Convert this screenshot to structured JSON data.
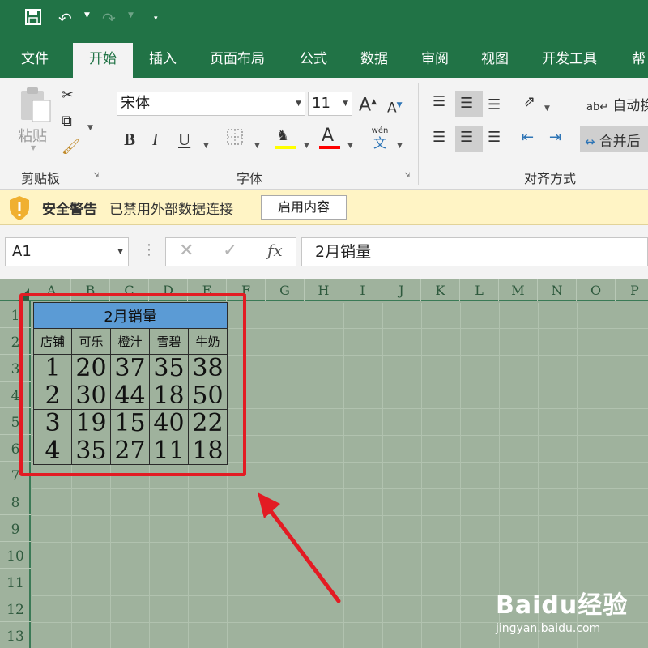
{
  "qat": {
    "save_icon": "save-icon",
    "undo_icon": "undo-icon",
    "redo_icon": "redo-icon",
    "customize_icon": "customize-qat-icon"
  },
  "tabs": [
    {
      "label": "文件"
    },
    {
      "label": "开始",
      "active": true
    },
    {
      "label": "插入"
    },
    {
      "label": "页面布局"
    },
    {
      "label": "公式"
    },
    {
      "label": "数据"
    },
    {
      "label": "审阅"
    },
    {
      "label": "视图"
    },
    {
      "label": "开发工具"
    },
    {
      "label": "帮"
    }
  ],
  "ribbon": {
    "clipboard": {
      "paste_label": "粘贴",
      "group_label": "剪贴板"
    },
    "font": {
      "font_name": "宋体",
      "font_size": "11",
      "bold": "B",
      "italic": "I",
      "underline": "U",
      "font_color_letter": "A",
      "phonetic_top": "wén",
      "phonetic_bottom": "文",
      "group_label": "字体",
      "fill_color": "#ffff00",
      "font_color": "#ff0000"
    },
    "alignment": {
      "wrap_label": "自动换",
      "merge_label": "合并后",
      "group_label": "对齐方式"
    }
  },
  "security_bar": {
    "title": "安全警告",
    "message": "已禁用外部数据连接",
    "button_label": "启用内容"
  },
  "formula_bar": {
    "name_box": "A1",
    "fx_label": "fx",
    "content": "2月销量"
  },
  "columns": [
    "A",
    "B",
    "C",
    "D",
    "E",
    "F",
    "G",
    "H",
    "I",
    "J",
    "K",
    "L",
    "M",
    "N",
    "O",
    "P"
  ],
  "rows": [
    "1",
    "2",
    "3",
    "4",
    "5",
    "6",
    "7",
    "8",
    "9",
    "10",
    "11",
    "12",
    "13"
  ],
  "sheet_table": {
    "title": "2月销量",
    "headers": [
      "店铺",
      "可乐",
      "橙汁",
      "雪碧",
      "牛奶"
    ],
    "rows": [
      [
        "1",
        "20",
        "37",
        "35",
        "38"
      ],
      [
        "2",
        "30",
        "44",
        "18",
        "50"
      ],
      [
        "3",
        "19",
        "15",
        "40",
        "22"
      ],
      [
        "4",
        "35",
        "27",
        "11",
        "18"
      ]
    ]
  },
  "colors": {
    "excel_green": "#217346",
    "sheet_bg": "#9fb29d",
    "title_fill": "#5b9bd5",
    "annotation_red": "#e31b23"
  },
  "watermark": {
    "brand": "Baidu经验",
    "url": "jingyan.baidu.com"
  }
}
